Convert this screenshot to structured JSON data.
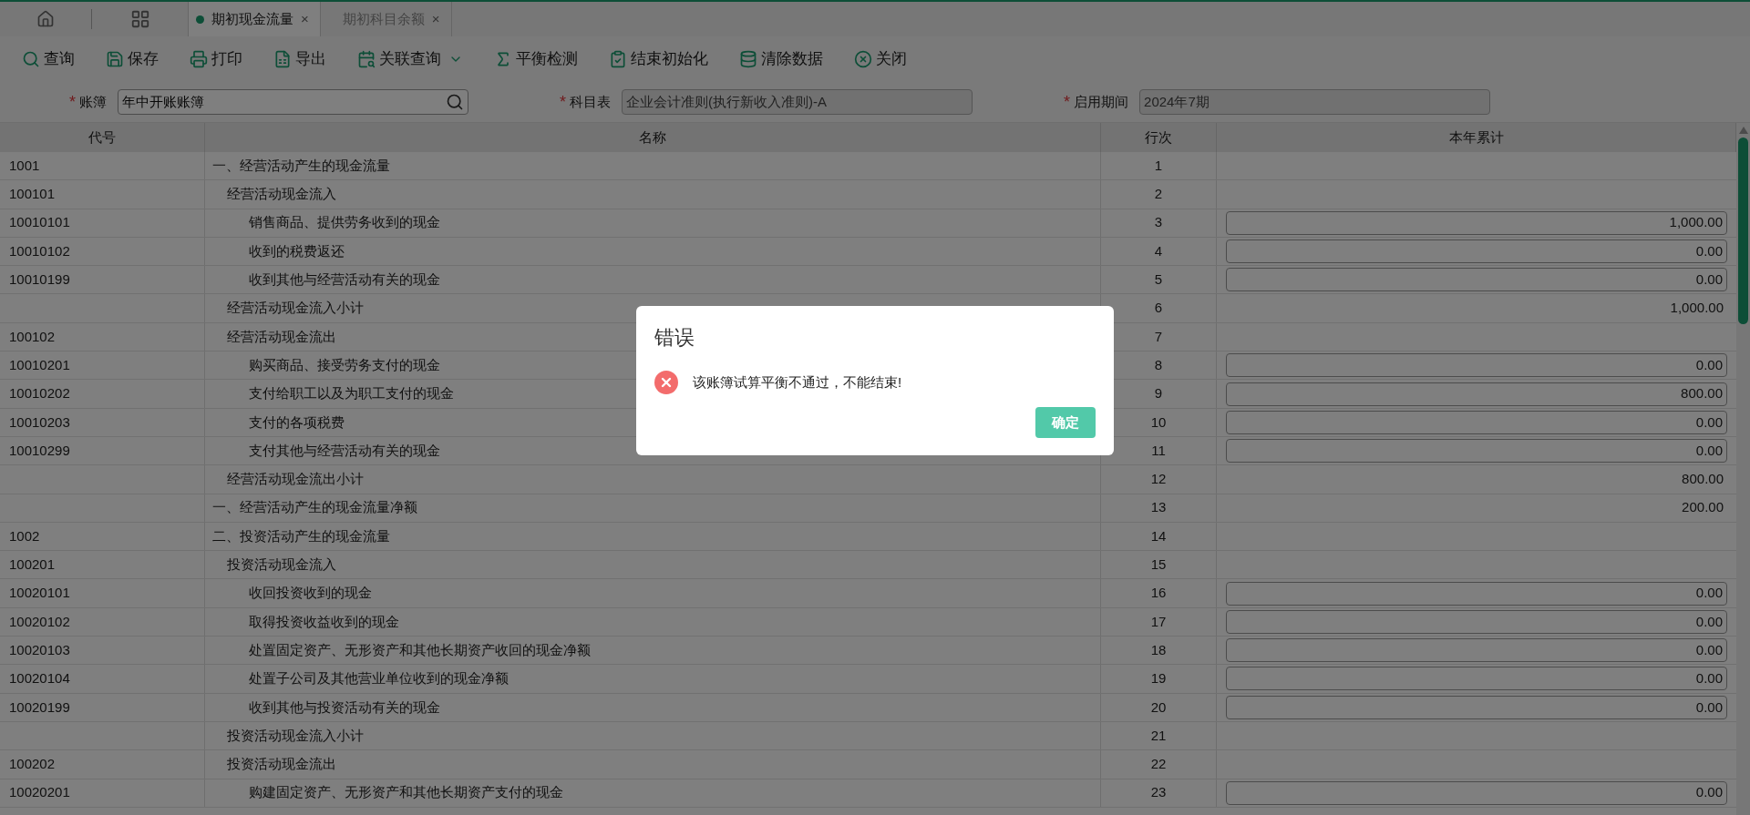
{
  "tabs": [
    {
      "label": "期初现金流量",
      "selected": true,
      "close": "×"
    },
    {
      "label": "期初科目余额",
      "selected": false,
      "close": "×"
    }
  ],
  "toolbar": [
    {
      "label": "查询",
      "dropdown": false
    },
    {
      "label": "保存",
      "dropdown": false
    },
    {
      "label": "打印",
      "dropdown": false
    },
    {
      "label": "导出",
      "dropdown": false
    },
    {
      "label": "关联查询",
      "dropdown": true
    },
    {
      "label": "平衡检测",
      "dropdown": false
    },
    {
      "label": "结束初始化",
      "dropdown": false
    },
    {
      "label": "清除数据",
      "dropdown": false
    },
    {
      "label": "关闭",
      "dropdown": false
    }
  ],
  "filters": [
    {
      "mark": "*",
      "label": "账簿",
      "value": "年中开账账簿",
      "disabled": false,
      "search": true
    },
    {
      "mark": "*",
      "label": "科目表",
      "value": "企业会计准则(执行新收入准则)-A",
      "disabled": true,
      "search": false
    },
    {
      "mark": "*",
      "label": "启用期间",
      "value": "2024年7期",
      "disabled": true,
      "search": false
    }
  ],
  "table": {
    "columns": [
      "代号",
      "名称",
      "行次",
      "本年累计"
    ],
    "rows": [
      {
        "code": "1001",
        "name": "一、经营活动产生的现金流量",
        "line": "1",
        "kind": "group",
        "children": [
          {
            "code": "100101",
            "name": "经营活动现金流入",
            "line": "2",
            "kind": "group",
            "children": [
              {
                "code": "10010101",
                "name": "销售商品、提供劳务收到的现金",
                "line": "3",
                "kind": "input",
                "value": "1,000.00"
              },
              {
                "code": "10010102",
                "name": "收到的税费返还",
                "line": "4",
                "kind": "input",
                "value": "0.00"
              },
              {
                "code": "10010199",
                "name": "收到其他与经营活动有关的现金",
                "line": "5",
                "kind": "input",
                "value": "0.00"
              }
            ]
          },
          {
            "name": "经营活动现金流入小计",
            "line": "6",
            "kind": "total",
            "value": "1,000.00"
          },
          {
            "code": "100102",
            "name": "经营活动现金流出",
            "line": "7",
            "kind": "group",
            "children": [
              {
                "code": "10010201",
                "name": "购买商品、接受劳务支付的现金",
                "line": "8",
                "kind": "input",
                "value": "0.00"
              },
              {
                "code": "10010202",
                "name": "支付给职工以及为职工支付的现金",
                "line": "9",
                "kind": "input",
                "value": "800.00"
              },
              {
                "code": "10010203",
                "name": "支付的各项税费",
                "line": "10",
                "kind": "input",
                "value": "0.00"
              },
              {
                "code": "10010299",
                "name": "支付其他与经营活动有关的现金",
                "line": "11",
                "kind": "input",
                "value": "0.00"
              }
            ]
          },
          {
            "name": "经营活动现金流出小计",
            "line": "12",
            "kind": "total",
            "value": "800.00"
          }
        ]
      },
      {
        "name": "一、经营活动产生的现金流量净额",
        "line": "13",
        "kind": "total",
        "value": "200.00"
      },
      {
        "code": "1002",
        "name": "二、投资活动产生的现金流量",
        "line": "14",
        "kind": "group",
        "children": [
          {
            "code": "100201",
            "name": "投资活动现金流入",
            "line": "15",
            "kind": "group",
            "children": [
              {
                "code": "10020101",
                "name": "收回投资收到的现金",
                "line": "16",
                "kind": "input",
                "value": "0.00"
              },
              {
                "code": "10020102",
                "name": "取得投资收益收到的现金",
                "line": "17",
                "kind": "input",
                "value": "0.00"
              },
              {
                "code": "10020103",
                "name": "处置固定资产、无形资产和其他长期资产收回的现金净额",
                "line": "18",
                "kind": "input",
                "value": "0.00"
              },
              {
                "code": "10020104",
                "name": "处置子公司及其他营业单位收到的现金净额",
                "line": "19",
                "kind": "input",
                "value": "0.00"
              },
              {
                "code": "10020199",
                "name": "收到其他与投资活动有关的现金",
                "line": "20",
                "kind": "input",
                "value": "0.00"
              }
            ]
          },
          {
            "name": "投资活动现金流入小计",
            "line": "21",
            "kind": "total"
          },
          {
            "code": "100202",
            "name": "投资活动现金流出",
            "line": "22",
            "kind": "group",
            "children": [
              {
                "code": "10020201",
                "name": "购建固定资产、无形资产和其他长期资产支付的现金",
                "line": "23",
                "kind": "input",
                "value": "0.00"
              }
            ]
          }
        ]
      }
    ]
  },
  "dialog": {
    "title": "错误",
    "message": "该账簿试算平衡不通过，不能结束!",
    "button": "确定"
  }
}
